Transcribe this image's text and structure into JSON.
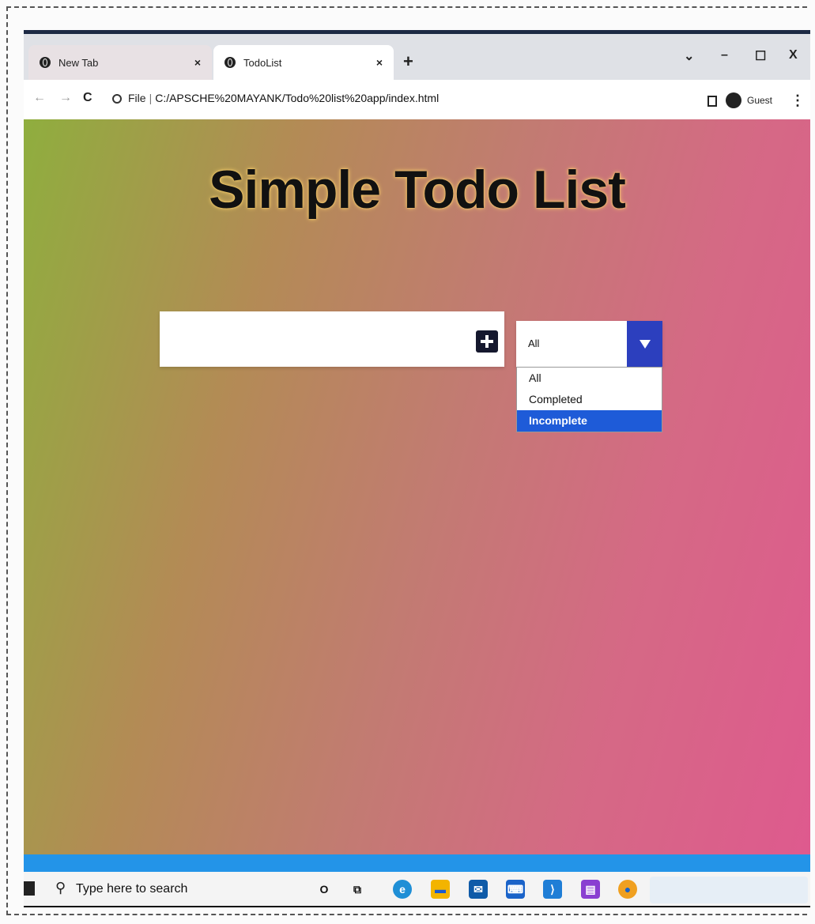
{
  "browser": {
    "tabs": [
      {
        "label": "New Tab",
        "active": false
      },
      {
        "label": "TodoList",
        "active": true
      }
    ],
    "tab_close": "×",
    "new_tab": "+",
    "window_controls": {
      "minimize": "–",
      "maximize": "☐",
      "close": "X",
      "dropdown": "⌄"
    },
    "address": {
      "file_label": "File",
      "separator": "|",
      "url": "C:/APSCHE%20MAYANK/Todo%20list%20app/index.html"
    },
    "profile_label": "Guest",
    "menu": "⋮"
  },
  "page": {
    "title": "Simple Todo List",
    "todo_input": {
      "value": "",
      "placeholder": ""
    },
    "filter": {
      "selected": "All",
      "options": [
        "All",
        "Completed",
        "Incomplete"
      ],
      "highlighted": "Incomplete"
    }
  },
  "taskbar": {
    "search_placeholder": "Type here to search",
    "apps": [
      "opera-icon",
      "task-view-icon",
      "edge-icon",
      "file-explorer-icon",
      "mail-icon",
      "feedback-icon",
      "vscode-icon",
      "app-icon",
      "chrome-icon"
    ]
  },
  "colors": {
    "accent": "#2c3fbe",
    "highlight": "#1e5bd8",
    "add_button": "#15182e",
    "taskbar_stripe": "#2394e8"
  }
}
